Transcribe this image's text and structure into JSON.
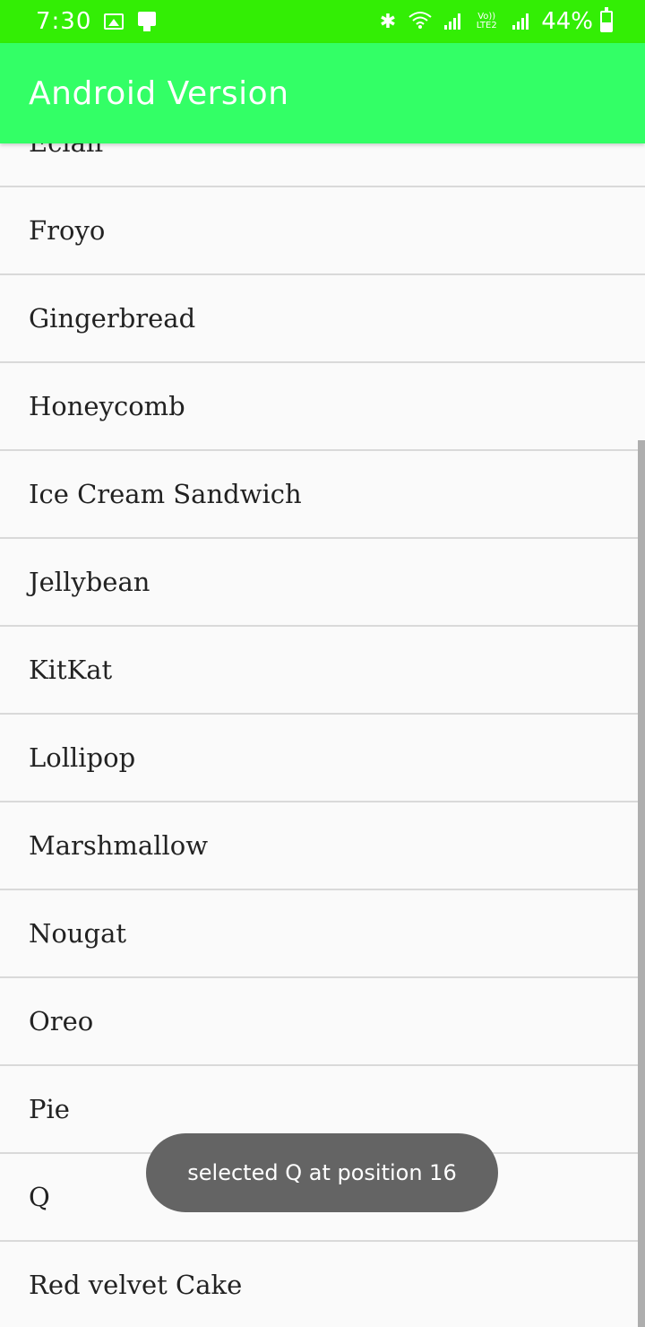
{
  "status_bar": {
    "time": "7:30",
    "volte_label": "Vo)) LTE2",
    "battery_percent": "44%",
    "battery_level": 0.44,
    "background_color": "#33ee05",
    "icons": [
      "gallery-icon",
      "device-icon",
      "bluetooth-icon",
      "wifi-icon",
      "signal-icon",
      "signal-icon",
      "battery-icon"
    ]
  },
  "app_bar": {
    "title": "Android Version",
    "background_color": "#33ff66"
  },
  "list": {
    "items": [
      "Eclair",
      "Froyo",
      "Gingerbread",
      "Honeycomb",
      "Ice Cream Sandwich",
      "Jellybean",
      "KitKat",
      "Lollipop",
      "Marshmallow",
      "Nougat",
      "Oreo",
      "Pie",
      "Q",
      "Red velvet Cake"
    ]
  },
  "toast": {
    "message": "selected Q at position 16"
  }
}
